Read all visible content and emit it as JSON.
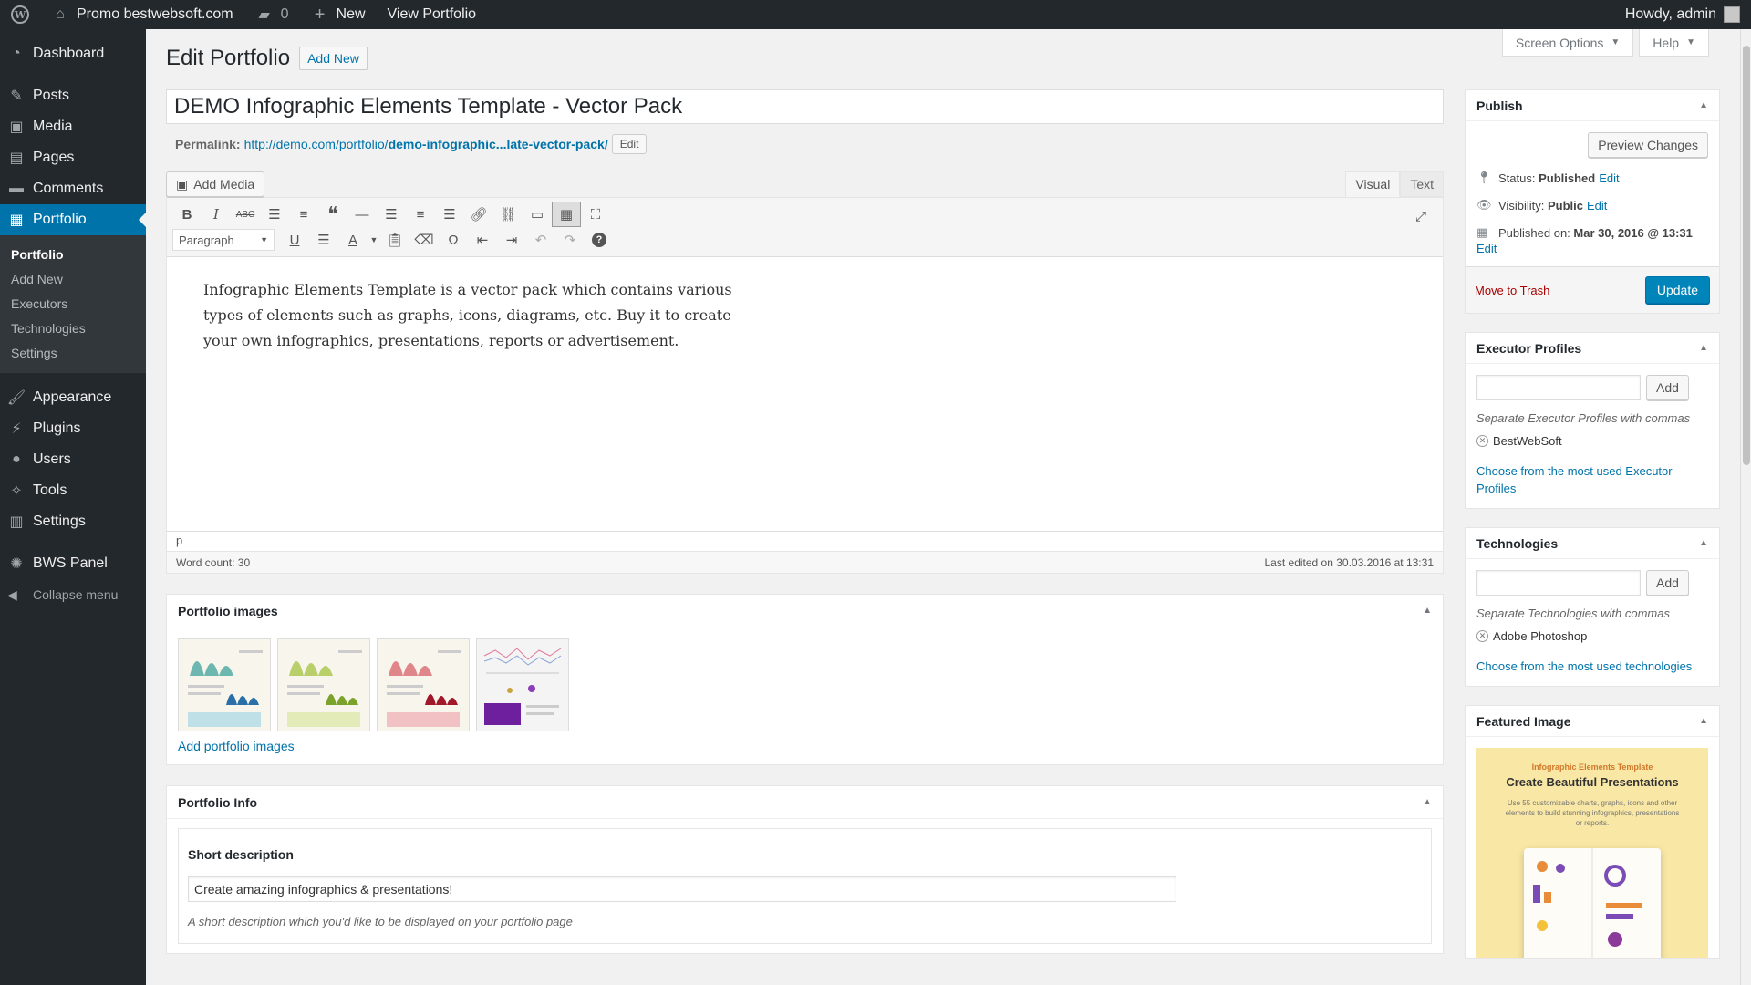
{
  "adminbar": {
    "site_name": "Promo bestwebsoft.com",
    "comments_count": "0",
    "new_label": "New",
    "view_label": "View Portfolio",
    "howdy": "Howdy, admin"
  },
  "sidebar": {
    "items_top": [
      {
        "label": "Dashboard",
        "icon": "dashboard-icon"
      }
    ],
    "items_mid": [
      {
        "label": "Posts",
        "icon": "pin-icon"
      },
      {
        "label": "Media",
        "icon": "media-icon"
      },
      {
        "label": "Pages",
        "icon": "pages-icon"
      },
      {
        "label": "Comments",
        "icon": "comment-icon"
      }
    ],
    "portfolio": {
      "label": "Portfolio",
      "icon": "portfolio-icon"
    },
    "submenu": [
      "Portfolio",
      "Add New",
      "Executors",
      "Technologies",
      "Settings"
    ],
    "items_bottom": [
      {
        "label": "Appearance",
        "icon": "brush-icon"
      },
      {
        "label": "Plugins",
        "icon": "plugin-icon"
      },
      {
        "label": "Users",
        "icon": "users-icon"
      },
      {
        "label": "Tools",
        "icon": "wrench-icon"
      },
      {
        "label": "Settings",
        "icon": "settings-icon"
      }
    ],
    "bws": "BWS Panel",
    "collapse": "Collapse menu"
  },
  "screen": {
    "options": "Screen Options",
    "help": "Help"
  },
  "page": {
    "title": "Edit Portfolio",
    "add_new": "Add New"
  },
  "post": {
    "title": "DEMO Infographic Elements Template - Vector Pack",
    "permalink_label": "Permalink:",
    "permalink_base": "http://demo.com/portfolio/",
    "permalink_slug": "demo-infographic...late-vector-pack/",
    "permalink_edit": "Edit"
  },
  "editor": {
    "add_media": "Add Media",
    "tab_visual": "Visual",
    "tab_text": "Text",
    "format": "Paragraph",
    "content": "Infographic Elements Template is a vector pack which contains various types of elements such as graphs, icons, diagrams, etc. Buy it to create your own infographics, presentations, reports or advertisement.",
    "path": "p",
    "word_count": "Word count: 30",
    "last_edited": "Last edited on 30.03.2016 at 13:31"
  },
  "portfolio_images": {
    "title": "Portfolio images",
    "add_link": "Add portfolio images"
  },
  "portfolio_info": {
    "title": "Portfolio Info",
    "short_desc_label": "Short description",
    "short_desc_value": "Create amazing infographics & presentations!",
    "short_desc_help": "A short description which you'd like to be displayed on your portfolio page"
  },
  "publish": {
    "title": "Publish",
    "preview": "Preview Changes",
    "status_label": "Status:",
    "status_value": "Published",
    "visibility_label": "Visibility:",
    "visibility_value": "Public",
    "published_label": "Published on:",
    "published_value": "Mar 30, 2016 @ 13:31",
    "edit": "Edit",
    "trash": "Move to Trash",
    "update": "Update"
  },
  "executors": {
    "title": "Executor Profiles",
    "add": "Add",
    "howto": "Separate Executor Profiles with commas",
    "tag": "BestWebSoft",
    "choose": "Choose from the most used Executor Profiles"
  },
  "technologies": {
    "title": "Technologies",
    "add": "Add",
    "howto": "Separate Technologies with commas",
    "tag": "Adobe Photoshop",
    "choose": "Choose from the most used technologies"
  },
  "featured": {
    "title": "Featured Image",
    "img_small": "Infographic Elements Template",
    "img_title": "Create Beautiful Presentations",
    "img_sub": "Use 55 customizable charts, graphs, icons and other elements to build stunning infographics, presentations or reports."
  },
  "colors": {
    "accent": "#0073aa",
    "sidebar": "#23282d",
    "update": "#0085ba"
  }
}
